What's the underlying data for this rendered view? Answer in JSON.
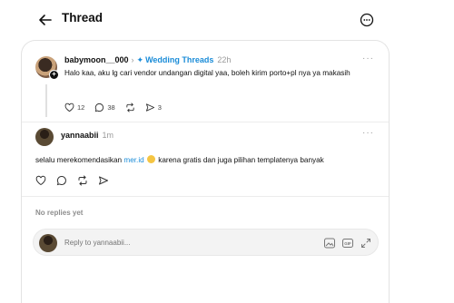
{
  "header": {
    "title": "Thread"
  },
  "post": {
    "username": "babymoon__000",
    "topic": "Wedding Threads",
    "time": "22h",
    "text": "Halo kaa, aku lg cari vendor undangan digital yaa, boleh kirim porto+pl nya ya makasih",
    "likes": "12",
    "replies": "38",
    "shares": "3",
    "more": "···"
  },
  "reply": {
    "username": "yannaabii",
    "time": "1m",
    "text_before": "selalu merekomendasikan ",
    "link": "mer.id",
    "text_after": " karena gratis dan juga pilihan templatenya banyak",
    "more": "···"
  },
  "replies_section": {
    "empty_label": "No replies yet"
  },
  "composer": {
    "placeholder": "Reply to yannaabii..."
  },
  "icons": [
    "back-arrow-icon",
    "more-circle-icon",
    "heart-icon",
    "comment-icon",
    "repost-icon",
    "share-icon",
    "image-icon",
    "gif-icon",
    "expand-icon"
  ],
  "colors": {
    "accent": "#1a8cd8",
    "muted": "#9a9a9a"
  }
}
